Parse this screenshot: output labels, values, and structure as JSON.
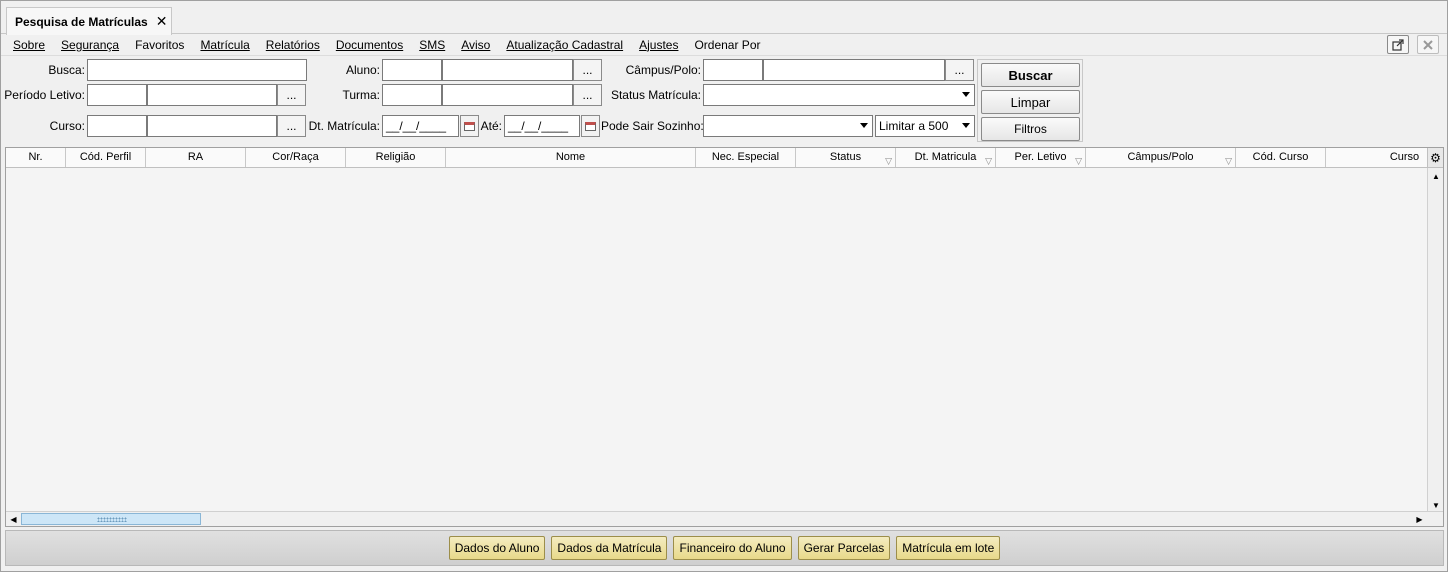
{
  "tab": {
    "title": "Pesquisa de Matrículas",
    "close_glyph": "✕"
  },
  "menu": [
    "Sobre",
    "Segurança",
    "Favoritos",
    "Matrícula",
    "Relatórios",
    "Documentos",
    "SMS",
    "Aviso",
    "Atualização Cadastral",
    "Ajustes",
    "Ordenar Por"
  ],
  "window_buttons": {
    "popout_icon": "external-window-icon",
    "close_icon": "close-icon"
  },
  "form": {
    "busca_label": "Busca:",
    "periodo_label": "Período Letivo:",
    "curso_label": "Curso:",
    "aluno_label": "Aluno:",
    "turma_label": "Turma:",
    "dt_matricula_label": "Dt. Matrícula:",
    "dt_matricula_value": "__/__/____",
    "ate_label": "Até:",
    "ate_value": "__/__/____",
    "campus_label": "Câmpus/Polo:",
    "status_label": "Status Matrícula:",
    "pode_sair_label": "Pode Sair Sozinho:",
    "limitar_value": "Limitar a 500",
    "ellipsis": "..."
  },
  "buttons": {
    "buscar": "Buscar",
    "limpar": "Limpar",
    "filtros": "Filtros"
  },
  "table": {
    "columns": [
      "Nr.",
      "Cód. Perfil",
      "RA",
      "Cor/Raça",
      "Religião",
      "Nome",
      "Nec. Especial",
      "Status",
      "Dt. Matricula",
      "Per. Letivo",
      "Câmpus/Polo",
      "Cód. Curso",
      "Curso"
    ],
    "rows": []
  },
  "bottom_buttons": [
    "Dados do Aluno",
    "Dados da Matrícula",
    "Financeiro do Aluno",
    "Gerar Parcelas",
    "Matrícula em lote"
  ],
  "colors": {
    "bottom_button_bg": "#ecdd9a",
    "scroll_thumb": "#cde6f7"
  }
}
